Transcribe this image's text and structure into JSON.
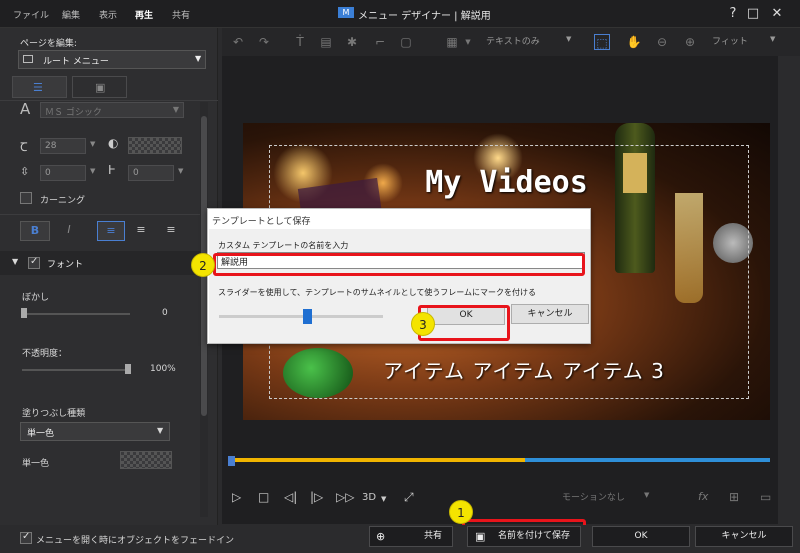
{
  "menu": {
    "items": [
      "ファイル",
      "編集",
      "表示",
      "再生",
      "共有"
    ],
    "active": "再生"
  },
  "app": {
    "title": "メニュー デザイナー | 解説用",
    "logo_text": "M",
    "help": "?",
    "restore": "□",
    "close": "✕"
  },
  "leftpanel": {
    "page_label": "ページを編集:",
    "page_select": "ルート メニュー",
    "font_name": "ＭＳ ゴシック",
    "font_size": "28",
    "line_spacing": "0",
    "char_spacing": "0",
    "kerning_label": "カーニング",
    "bold": "B",
    "italic": "I",
    "font_section": "フォント",
    "blur_label": "ぼかし",
    "blur_value": "0",
    "opacity_label": "不透明度：",
    "opacity_value": "100%",
    "fill_label": "塗りつぶし種類",
    "fill_select": "単一色",
    "solid_label": "単一色",
    "fade_label": "メニューを開く時にオブジェクトをフェードイン"
  },
  "toolbar": {
    "text_mode": "テキストのみ",
    "zoom": "フィット"
  },
  "stage": {
    "title": "My Videos",
    "items": "アイテム アイテム アイテム 3"
  },
  "dialog": {
    "title": "テンプレートとして保存",
    "name_prompt": "カスタム テンプレートの名前を入力",
    "name_value": "解説用",
    "slider_prompt": "スライダーを使用して、テンプレートのサムネイルとして使うフレームにマークを付ける",
    "ok": "OK",
    "cancel": "キャンセル"
  },
  "player": {
    "label_3d": "3D",
    "motion": "モーションなし",
    "fx": "fx"
  },
  "bottom": {
    "share": "共有",
    "save_as": "名前を付けて保存",
    "ok": "OK",
    "cancel": "キャンセル"
  },
  "callouts": [
    "1",
    "2",
    "3"
  ],
  "colors": {
    "accent": "#3b7fd6",
    "highlight": "#e8141b",
    "callout": "#f4e400",
    "timeline_played": "#f0b400",
    "timeline_rest": "#2e8fd8"
  }
}
